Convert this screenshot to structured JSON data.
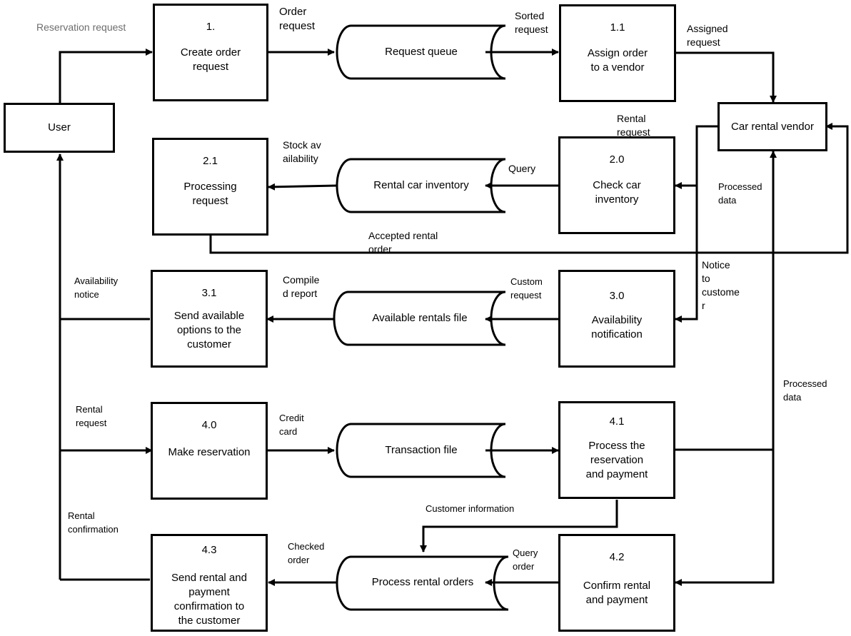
{
  "diagram": {
    "type": "data-flow-diagram",
    "entities": {
      "user": "User",
      "vendor": "Car rental vendor"
    },
    "processes": {
      "p1": {
        "num": "1.",
        "name": "Create order\nrequest"
      },
      "p11": {
        "num": "1.1",
        "name": "Assign order\nto a vendor"
      },
      "p21": {
        "num": "2.1",
        "name": "Processing\nrequest"
      },
      "p20": {
        "num": "2.0",
        "name": "Check car\ninventory"
      },
      "p31": {
        "num": "3.1",
        "name": "Send available\noptions to the\ncustomer"
      },
      "p30": {
        "num": "3.0",
        "name": "Availability\nnotification"
      },
      "p40": {
        "num": "4.0",
        "name": "Make reservation"
      },
      "p41": {
        "num": "4.1",
        "name": "Process the\nreservation\nand payment"
      },
      "p43": {
        "num": "4.3",
        "name": "Send rental and\npayment\nconfirmation to\nthe customer"
      },
      "p42": {
        "num": "4.2",
        "name": "Confirm rental\nand payment"
      }
    },
    "stores": {
      "request_queue": "Request queue",
      "inventory": "Rental car inventory",
      "available_rentals": "Available rentals file",
      "transaction": "Transaction file",
      "rental_orders": "Process rental orders"
    },
    "flows": {
      "reservation_request": "Reservation request",
      "order_request": "Order\nrequest",
      "sorted_request": "Sorted\nrequest",
      "assigned_request": "Assigned\nrequest",
      "rental_request_vendor": "Rental\nrequest",
      "stock_availability": "Stock av\nailability",
      "query": "Query",
      "processed_data_1": "Processed\ndata",
      "accepted_rental_order": "Accepted rental\norder",
      "availability_notice": "Availability\nnotice",
      "compiled_report": "Compile\nd report",
      "custom_request": "Custom\nrequest",
      "notice_to_customer": "Notice\nto\ncustome\nr",
      "processed_data_2": "Processed\ndata",
      "rental_request_user": "Rental\nrequest",
      "credit_card": "Credit\ncard",
      "customer_information": "Customer information",
      "rental_confirmation": "Rental\nconfirmation",
      "checked_order": "Checked\norder",
      "query_order": "Query\norder"
    }
  }
}
